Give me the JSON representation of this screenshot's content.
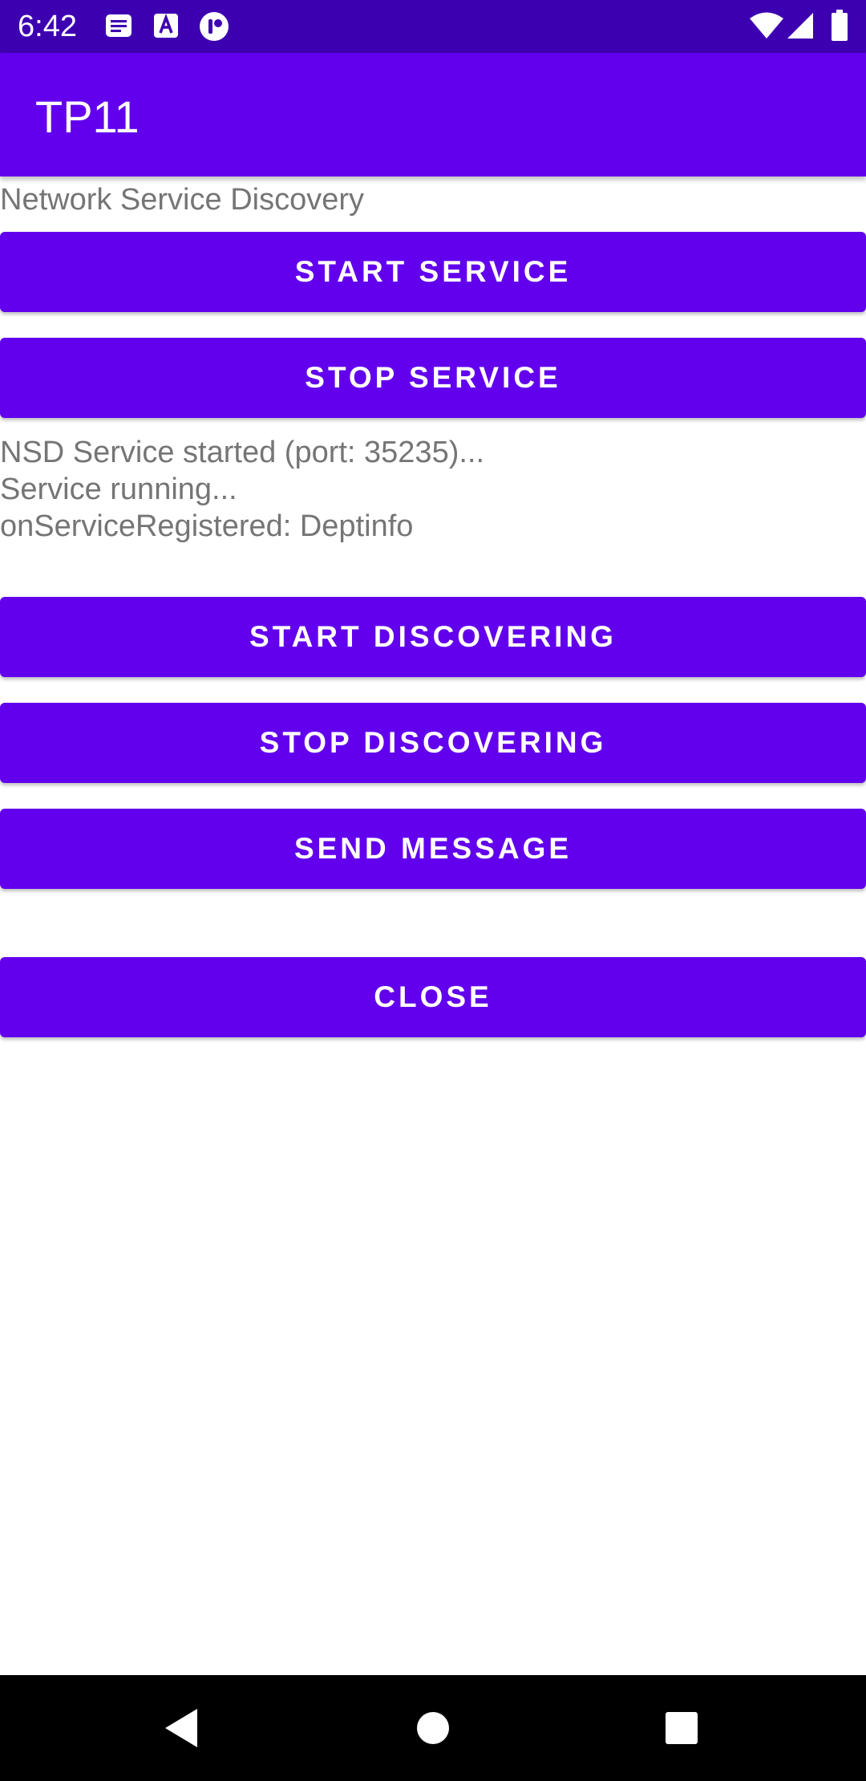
{
  "status_bar": {
    "time": "6:42",
    "left_icons": [
      "notes-icon",
      "font-a-icon",
      "app-badge-icon"
    ],
    "right_icons": [
      "wifi-icon",
      "cell-signal-icon",
      "battery-icon"
    ]
  },
  "app_bar": {
    "title": "TP11"
  },
  "main": {
    "subtitle": "Network Service Discovery",
    "buttons": {
      "start_service": "START SERVICE",
      "stop_service": "STOP SERVICE",
      "start_discovering": "START DISCOVERING",
      "stop_discovering": "STOP DISCOVERING",
      "send_message": "SEND MESSAGE",
      "close": "CLOSE"
    },
    "log": [
      "NSD Service started (port: 35235)...",
      "Service running...",
      "onServiceRegistered: Deptinfo"
    ]
  },
  "nav_bar": {
    "icons": [
      "back-icon",
      "home-icon",
      "recents-icon"
    ]
  },
  "colors": {
    "primary": "#6200ee",
    "status_bar": "#3d00b0",
    "secondary_text": "#757575"
  }
}
